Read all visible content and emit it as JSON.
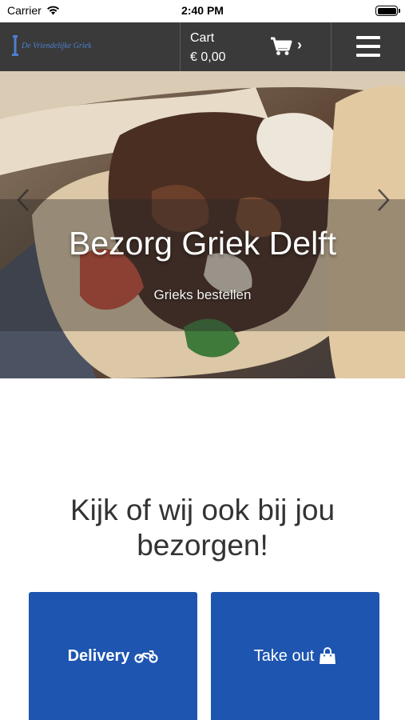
{
  "status_bar": {
    "carrier": "Carrier",
    "time": "2:40 PM"
  },
  "header": {
    "logo_text": "De Vriendelijke Griek",
    "cart_label": "Cart",
    "cart_total": "€ 0,00",
    "cart_chevron": "›",
    "icons": [
      "logo-icon",
      "cart-icon",
      "menu-icon"
    ]
  },
  "hero": {
    "title": "Bezorg Griek Delft",
    "subtitle": "Grieks bestellen",
    "icons": [
      "chevron-left-icon",
      "chevron-right-icon"
    ]
  },
  "main": {
    "headline": "Kijk of wij ook bij jou bezorgen!",
    "delivery_label": "Delivery",
    "takeout_label": "Take out",
    "icons": [
      "motorcycle-icon",
      "shopping-bag-icon"
    ]
  },
  "colors": {
    "header_bg": "#3a3a3a",
    "button_bg": "#1d55b0",
    "logo_blue": "#4d7fd0"
  }
}
